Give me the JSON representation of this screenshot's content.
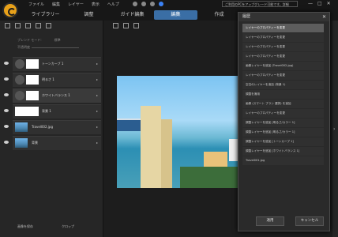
{
  "menu": [
    "ファイル",
    "編集",
    "レイヤー",
    "表示",
    "ヘルプ"
  ],
  "tabs": [
    {
      "label": "ライブラリー",
      "active": false
    },
    {
      "label": "調整",
      "active": false
    },
    {
      "label": "ガイド編集",
      "active": false
    },
    {
      "label": "編集",
      "active": true
    },
    {
      "label": "作成",
      "active": false
    }
  ],
  "notice": "ご利用のPCをアップグレード可能です。詳細",
  "window_buttons": [
    "—",
    "□",
    "✕"
  ],
  "layers_panel": {
    "blend_label": "ブレンド モード:",
    "blend_value": "標準",
    "opacity_label": "不透明度",
    "layers": [
      {
        "name": "トーンカーブ 1",
        "type": "adjust",
        "selected": false
      },
      {
        "name": "明るさ 1",
        "type": "adjust",
        "selected": false
      },
      {
        "name": "ホワイトバランス 1",
        "type": "adjust",
        "selected": true
      },
      {
        "name": "背景 1",
        "type": "blank",
        "selected": false
      },
      {
        "name": "Travel002.jpg",
        "type": "photo",
        "selected": false
      },
      {
        "name": "背景",
        "type": "photo",
        "selected": false
      }
    ],
    "bottom_buttons": [
      "画像を保存",
      "クロップ"
    ]
  },
  "history_panel": {
    "title": "履歴",
    "items": [
      "レイヤーのプロパティーを変更",
      "レイヤーのプロパティーを変更",
      "レイヤーのプロパティーを変更",
      "レイヤーのプロパティーを変更",
      "画像レイヤーを追加 (Travel002.jpg)",
      "レイヤーのプロパティーを変更",
      "空白のレイヤーを追加 (背景 1)",
      "調整を適用",
      "画像 (スマート ブラシ 選択) を追加",
      "レイヤーのプロパティーを変更",
      "調整レイヤーを追加 [明るさ/カラー 1]",
      "調整レイヤーを追加 [明るさ/カラー 1]",
      "調整レイヤーを追加 [トーンカーブ 1]",
      "調整レイヤーを追加 [ホワイトバランス 1]",
      "Travel001.jpg"
    ],
    "apply_label": "適用",
    "cancel_label": "キャンセル"
  }
}
